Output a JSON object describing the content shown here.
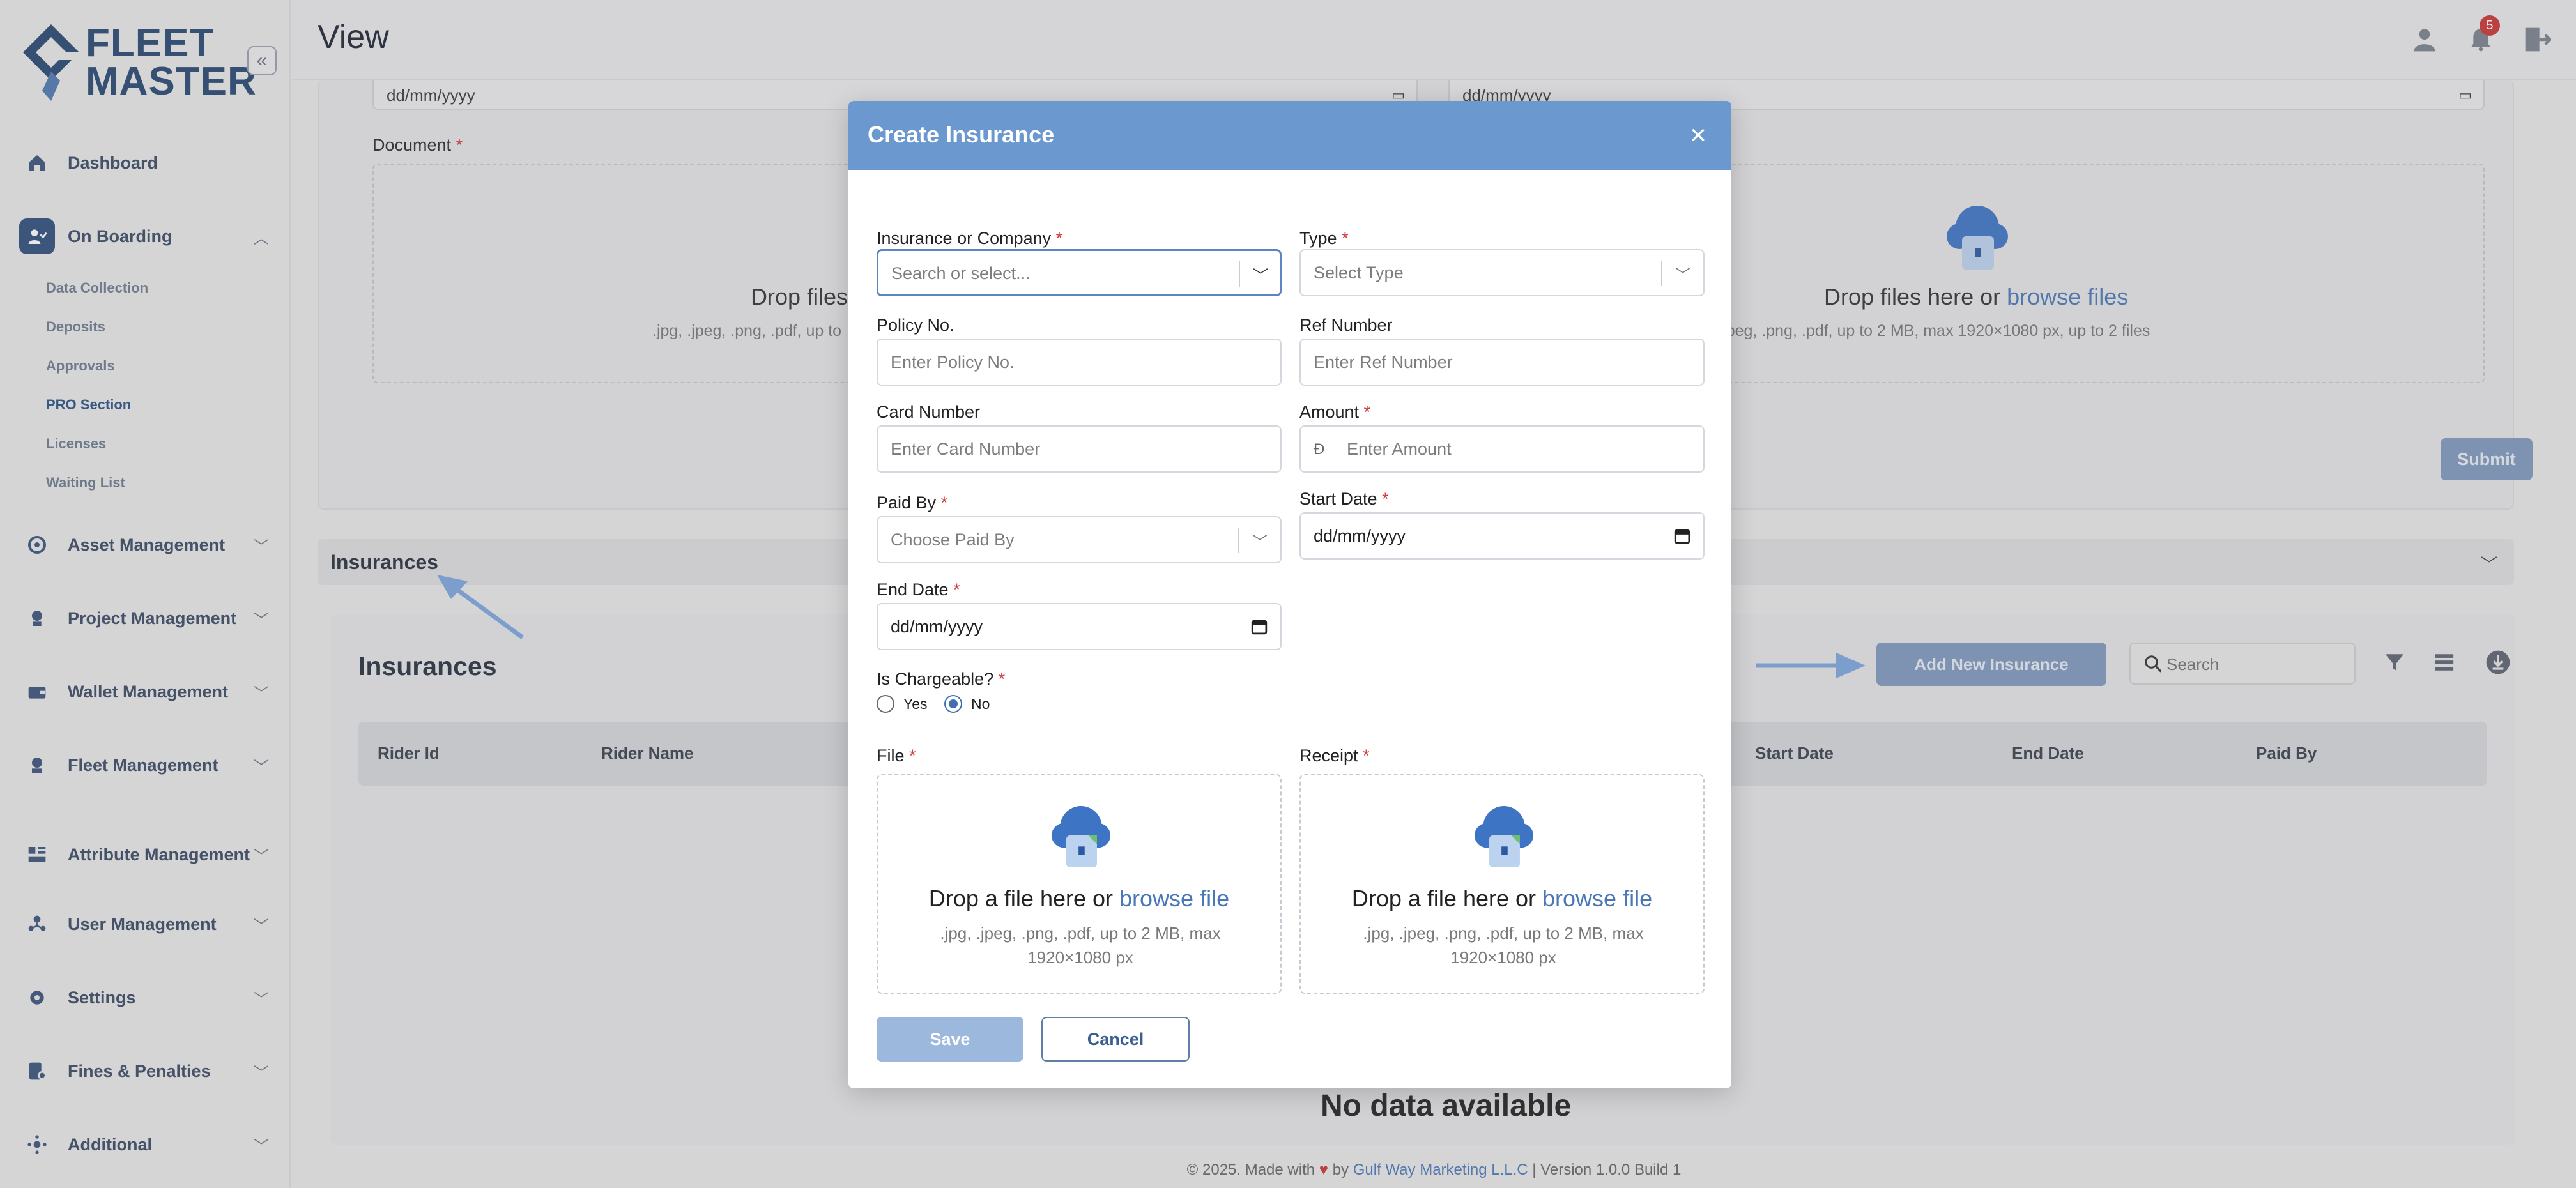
{
  "brand": {
    "line1": "FLEET",
    "line2": "MASTER"
  },
  "header": {
    "title": "View",
    "notification_count": "5"
  },
  "sidebar": {
    "items": [
      {
        "label": "Dashboard",
        "icon": "home-icon"
      },
      {
        "label": "On Boarding",
        "icon": "onboarding-icon",
        "expanded": true
      },
      {
        "label": "Asset Management",
        "icon": "asset-icon"
      },
      {
        "label": "Project Management",
        "icon": "project-icon"
      },
      {
        "label": "Wallet Management",
        "icon": "wallet-icon"
      },
      {
        "label": "Fleet Management",
        "icon": "fleet-icon"
      },
      {
        "label": "Attribute Management",
        "icon": "attribute-icon"
      },
      {
        "label": "User Management",
        "icon": "users-icon"
      },
      {
        "label": "Settings",
        "icon": "gear-icon"
      },
      {
        "label": "Fines & Penalties",
        "icon": "fines-icon"
      },
      {
        "label": "Additional",
        "icon": "additional-icon"
      }
    ],
    "onboarding_sub": [
      "Data Collection",
      "Deposits",
      "Approvals",
      "PRO Section",
      "Licenses",
      "Waiting List"
    ],
    "current_sub": "PRO Section"
  },
  "background": {
    "date_placeholder": "dd/mm/yyyy",
    "document_label": "Document",
    "drop_text_left": "Drop files",
    "drop_sub_left": ".jpg, .jpeg, .png, .pdf, up to",
    "drop_text_right": "Drop files here or",
    "drop_link_right": "browse files",
    "drop_sub_right": ".jpg, .jpeg, .png, .pdf, up to 2 MB, max 1920×1080 px, up to 2 files",
    "submit_label": "Submit",
    "section_title": "Insurances",
    "card_title": "Insurances",
    "add_button": "Add New Insurance",
    "search_placeholder": "Search",
    "columns": [
      "Rider Id",
      "Rider Name",
      "Start Date",
      "End Date",
      "Paid By"
    ],
    "no_data": "No data available",
    "footer": {
      "prefix": "© 2025. Made with",
      "by": "by",
      "company": "Gulf Way Marketing L.L.C",
      "version": "| Version 1.0.0 Build 1"
    }
  },
  "modal": {
    "title": "Create Insurance",
    "fields": {
      "insurance_company": {
        "label": "Insurance or Company",
        "placeholder": "Search or select..."
      },
      "type": {
        "label": "Type",
        "placeholder": "Select Type"
      },
      "policy_no": {
        "label": "Policy No.",
        "placeholder": "Enter Policy No."
      },
      "ref_number": {
        "label": "Ref Number",
        "placeholder": "Enter Ref Number"
      },
      "card_number": {
        "label": "Card Number",
        "placeholder": "Enter Card Number"
      },
      "amount": {
        "label": "Amount",
        "placeholder": "Enter Amount",
        "currency_symbol": "Đ"
      },
      "paid_by": {
        "label": "Paid By",
        "placeholder": "Choose Paid By"
      },
      "start_date": {
        "label": "Start Date",
        "value": "dd/mm/yyyy"
      },
      "end_date": {
        "label": "End Date",
        "value": "dd/mm/yyyy"
      },
      "is_chargeable": {
        "label": "Is Chargeable?",
        "options": [
          "Yes",
          "No"
        ],
        "selected": "No"
      },
      "file": {
        "label": "File"
      },
      "receipt": {
        "label": "Receipt"
      }
    },
    "dropzone": {
      "text": "Drop a file here or",
      "link": "browse file",
      "hint": ".jpg, .jpeg, .png, .pdf, up to 2 MB, max 1920×1080 px"
    },
    "save_label": "Save",
    "cancel_label": "Cancel"
  },
  "colors": {
    "accent": "#6b98cf",
    "brand": "#27476f",
    "required": "#d23b3b",
    "link": "#4a78b6"
  }
}
